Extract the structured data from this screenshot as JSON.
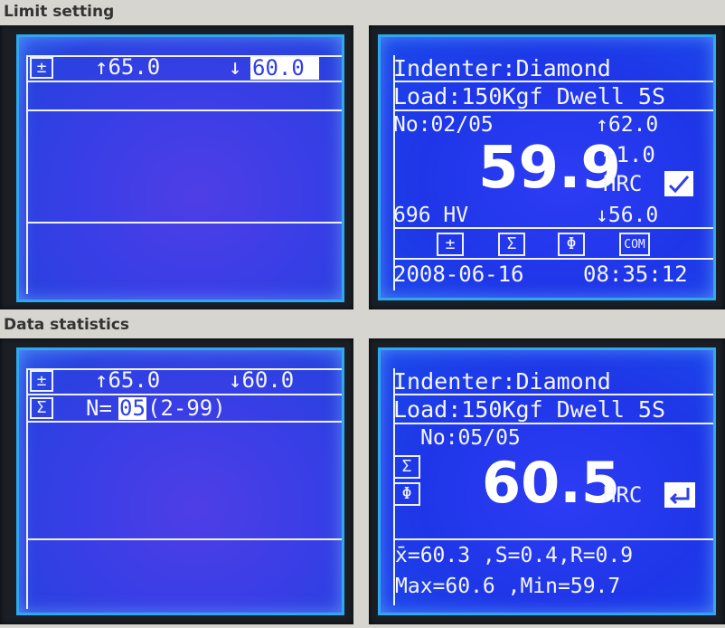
{
  "sections": {
    "limit_setting": "Limit setting",
    "data_statistics": "Data statistics"
  },
  "panel1": {
    "limit_icon": "±",
    "upper": "↑65.0",
    "lower_arrow": "↓",
    "lower": "60.0"
  },
  "panel2": {
    "indenter": "Indenter:Diamond",
    "load": "Load:150Kgf Dwell 5S",
    "no": "No:02/05",
    "upper": "↑62.0",
    "value": "59.9",
    "deviation": "+1.0",
    "scale": "HRC",
    "hv": "696 HV",
    "lower": "↓56.0",
    "icons": [
      "±",
      "Σ",
      "Φ",
      "COM"
    ],
    "date": "2008-06-16",
    "time": "08:35:12"
  },
  "panel3": {
    "limit_icon": "±",
    "upper": "↑65.0",
    "lower": "↓60.0",
    "sigma_icon": "Σ",
    "n_label": "N=",
    "n_value": "05",
    "n_range": "(2-99)"
  },
  "panel4": {
    "indenter": "Indenter:Diamond",
    "load": "Load:150Kgf Dwell 5S",
    "no": "No:05/05",
    "sigma_icon": "Σ",
    "phi_icon": "Φ",
    "value": "60.5",
    "scale": "HRC",
    "stats1": "x̄=60.3 ,S=0.4,R=0.9",
    "stats2": "Max=60.6 ,Min=59.7"
  }
}
